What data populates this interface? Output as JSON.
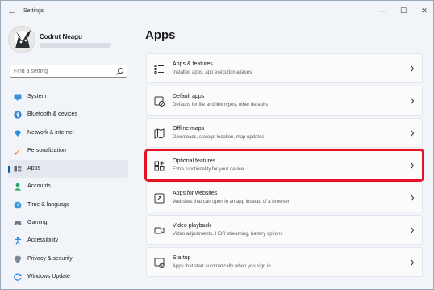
{
  "window": {
    "title": "Settings",
    "back_glyph": "←",
    "min_glyph": "—",
    "max_glyph": "☐",
    "close_glyph": "✕"
  },
  "profile": {
    "name": "Codrut Neagu"
  },
  "search": {
    "placeholder": "Find a setting"
  },
  "sidebar": {
    "items": [
      {
        "label": "System",
        "icon": "monitor-icon"
      },
      {
        "label": "Bluetooth & devices",
        "icon": "bluetooth-icon"
      },
      {
        "label": "Network & internet",
        "icon": "wifi-icon"
      },
      {
        "label": "Personalization",
        "icon": "brush-icon"
      },
      {
        "label": "Apps",
        "icon": "apps-icon",
        "active": true
      },
      {
        "label": "Accounts",
        "icon": "person-icon"
      },
      {
        "label": "Time & language",
        "icon": "globe-clock-icon"
      },
      {
        "label": "Gaming",
        "icon": "gamepad-icon"
      },
      {
        "label": "Accessibility",
        "icon": "accessibility-icon"
      },
      {
        "label": "Privacy & security",
        "icon": "shield-icon"
      },
      {
        "label": "Windows Update",
        "icon": "update-icon"
      }
    ]
  },
  "main": {
    "title": "Apps",
    "cards": [
      {
        "title": "Apps & features",
        "subtitle": "Installed apps, app execution aliases",
        "icon": "list-icon"
      },
      {
        "title": "Default apps",
        "subtitle": "Defaults for file and link types, other defaults",
        "icon": "default-apps-icon"
      },
      {
        "title": "Offline maps",
        "subtitle": "Downloads, storage location, map updates",
        "icon": "map-icon"
      },
      {
        "title": "Optional features",
        "subtitle": "Extra functionality for your device",
        "icon": "add-grid-icon",
        "highlighted": true
      },
      {
        "title": "Apps for websites",
        "subtitle": "Websites that can open in an app instead of a browser",
        "icon": "link-window-icon"
      },
      {
        "title": "Video playback",
        "subtitle": "Video adjustments, HDR streaming, battery options",
        "icon": "video-icon"
      },
      {
        "title": "Startup",
        "subtitle": "Apps that start automatically when you sign in",
        "icon": "startup-icon"
      }
    ]
  },
  "colors": {
    "accent": "#005fb8",
    "highlight": "#e81123",
    "background": "#f1f4f9"
  }
}
